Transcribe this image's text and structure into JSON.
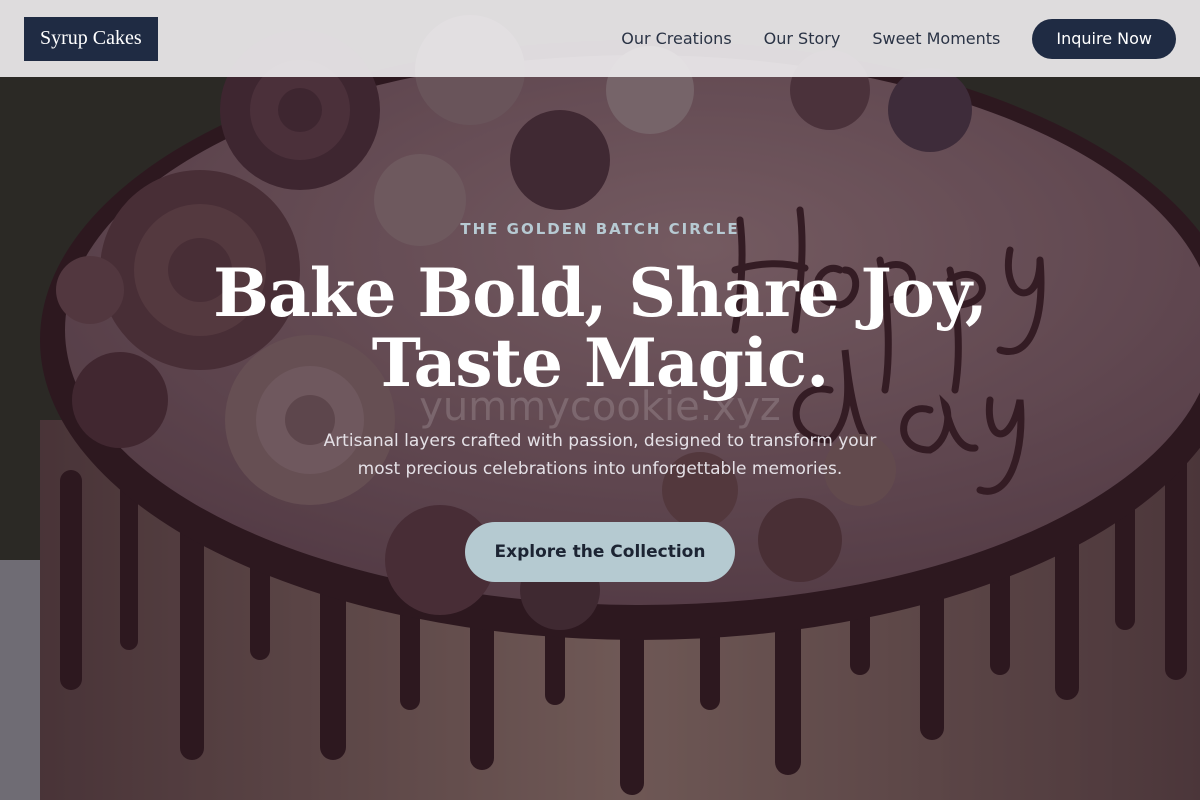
{
  "header": {
    "logo_text": "Syrup Cakes",
    "nav": [
      {
        "label": "Our Creations"
      },
      {
        "label": "Our Story"
      },
      {
        "label": "Sweet Moments"
      }
    ],
    "cta_label": "Inquire Now"
  },
  "hero": {
    "eyebrow": "THE GOLDEN BATCH CIRCLE",
    "headline_line1": "Bake Bold, Share Joy,",
    "headline_line2": "Taste Magic.",
    "subtext": "Artisanal layers crafted with passion, designed to transform your most precious celebrations into unforgettable memories.",
    "cta_label": "Explore the Collection",
    "watermark": "yummycookie.xyz",
    "cake_lettering": "Happy Birthday"
  },
  "colors": {
    "brand_navy": "#1f2b43",
    "cta_light_blue": "#b5cad1",
    "eyebrow": "#b7cad3"
  }
}
